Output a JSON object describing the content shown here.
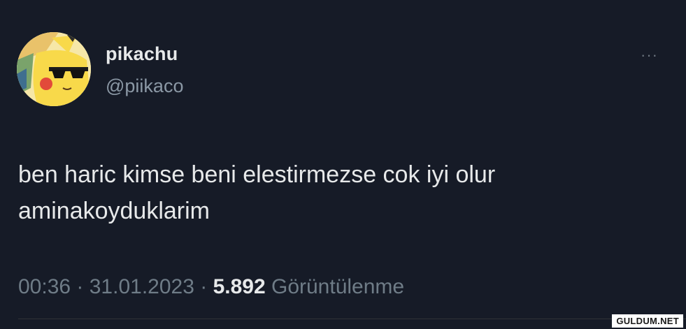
{
  "tweet": {
    "display_name": "pikachu",
    "handle": "@piikaco",
    "more_label": "···",
    "text_line1": "ben haric kimse beni elestirmezse cok iyi olur",
    "text_line2": "aminakoyduklarim",
    "time": "00:36",
    "sep1": " · ",
    "date": "31.01.2023",
    "sep2": " · ",
    "views_count": "5.892",
    "views_label": " Görüntülenme"
  },
  "watermark": "GULDUM.NET",
  "colors": {
    "background": "#161b27",
    "primary_text": "#e7e9ea",
    "secondary_text": "#8b98a5"
  },
  "icons": {
    "avatar": "pikachu-sunglasses-avatar",
    "more": "more-horizontal-icon"
  }
}
